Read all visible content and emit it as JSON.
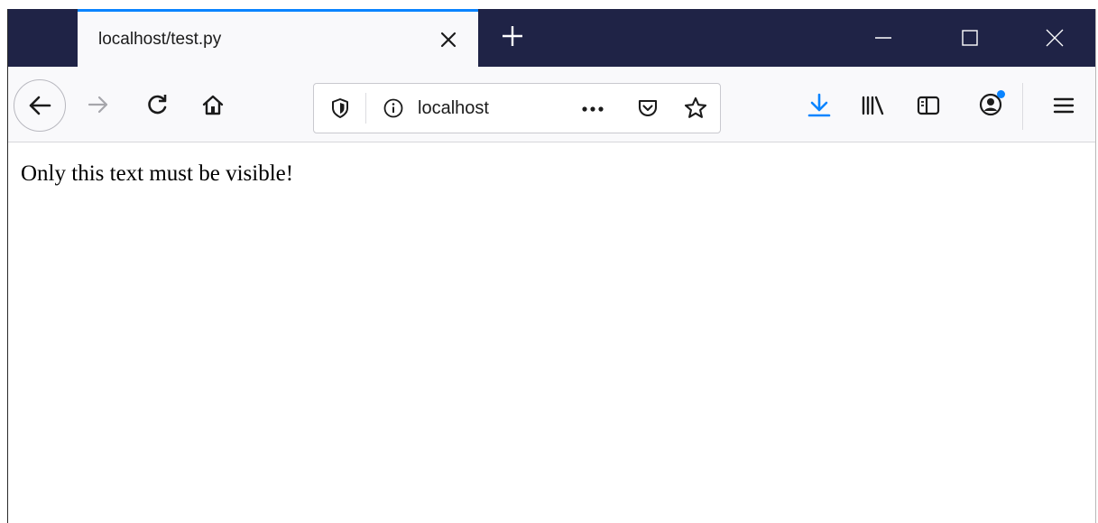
{
  "tab": {
    "title": "localhost/test.py"
  },
  "urlbar": {
    "value": "localhost"
  },
  "page": {
    "body_text": "Only this text must be visible!"
  },
  "icons": {
    "tab_close": "close-icon",
    "new_tab": "plus-icon",
    "minimize": "minimize-icon",
    "maximize": "maximize-icon",
    "close_window": "close-icon",
    "back": "arrow-left-icon",
    "forward": "arrow-right-icon",
    "reload": "reload-icon",
    "home": "home-icon",
    "tracking_protection": "shield-icon",
    "site_info": "info-icon",
    "page_actions": "ellipsis-icon",
    "pocket": "pocket-icon",
    "bookmark": "star-icon",
    "downloads": "download-icon",
    "library": "library-icon",
    "sidebars": "sidebar-icon",
    "account": "account-icon",
    "menu": "hamburger-icon"
  },
  "colors": {
    "tabbar_bg": "#1f2346",
    "active_tab_accent": "#0a84ff",
    "toolbar_bg": "#f9f9fb",
    "download_accent": "#0a84ff"
  }
}
